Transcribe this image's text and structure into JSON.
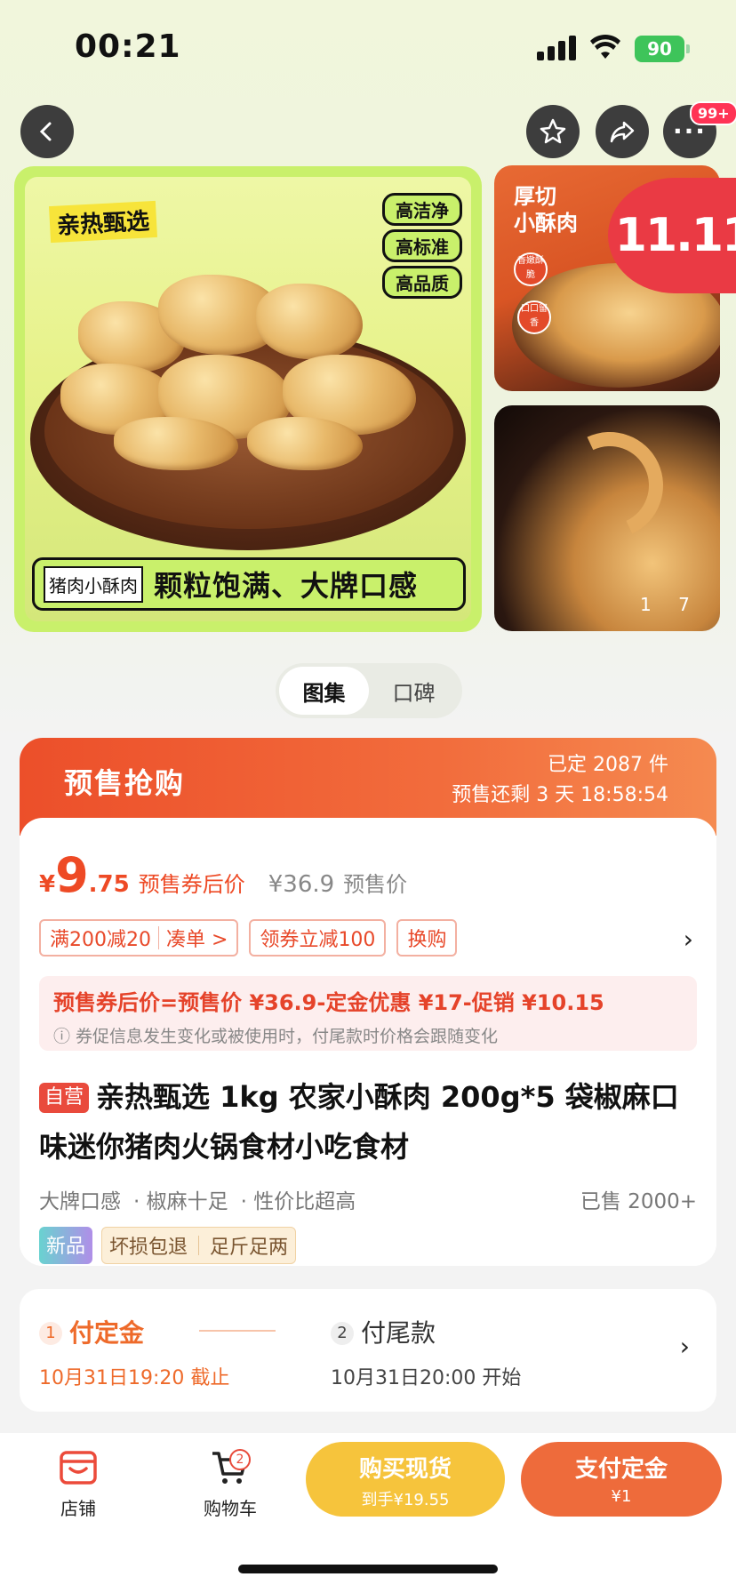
{
  "status_bar": {
    "time": "00:21",
    "battery": "90"
  },
  "nav": {
    "badge": "99+"
  },
  "gallery": {
    "main": {
      "brand": "亲热甄选",
      "quality_tags": [
        "高洁净",
        "高标准",
        "高品质"
      ],
      "caption_tag": "猪肉小酥肉",
      "caption_text": "颗粒饱满、大牌口感"
    },
    "side1": {
      "title_line1": "厚切",
      "title_line2": "小酥肉",
      "badge1": "香嫩酥脆",
      "badge2": "口口留香"
    },
    "sale_badge": "11.11",
    "counter_current": "1",
    "counter_total": "7"
  },
  "tabs": [
    "图集",
    "口碑"
  ],
  "presale": {
    "title": "预售抢购",
    "booked": "已定 2087 件",
    "remaining": "预售还剩 3 天 18:58:54",
    "price_currency": "¥",
    "price_int": "9",
    "price_dec": ".75",
    "price_label": "预售券后价",
    "orig_price": "¥36.9",
    "orig_label": "预售价",
    "coupons": [
      "满200减20",
      "凑单 >",
      "领券立减100",
      "换购"
    ],
    "formula": "预售券后价=预售价 ¥36.9-定金优惠 ¥17-促销 ¥10.15",
    "formula_note": "ⓘ 券促信息发生变化或被使用时，付尾款时价格会跟随变化",
    "self_operated": "自营",
    "title_text": "亲热甄选 1kg 农家小酥肉 200g*5 袋椒麻口味迷你猪肉火锅食材小吃食材",
    "features": [
      "大牌口感",
      "· 椒麻十足",
      "· 性价比超高"
    ],
    "sold": "已售 2000+",
    "tag_new": "新品",
    "service_tags": [
      "坏损包退",
      "足斤足两"
    ]
  },
  "steps": {
    "step1_num": "1",
    "step1_title": "付定金",
    "step1_time": "10月31日19:20 截止",
    "step2_num": "2",
    "step2_title": "付尾款",
    "step2_time": "10月31日20:00 开始"
  },
  "bottom": {
    "shop_label": "店铺",
    "cart_label": "购物车",
    "cart_count": "2",
    "buy_now": "购买现货",
    "buy_now_sub": "到手¥19.55",
    "pay_deposit": "支付定金",
    "pay_deposit_sub": "¥1"
  },
  "colors": {
    "accent": "#ee4a25",
    "buy": "#f6c43c",
    "deposit": "#ee6b3b",
    "lime": "#c9f06b"
  }
}
